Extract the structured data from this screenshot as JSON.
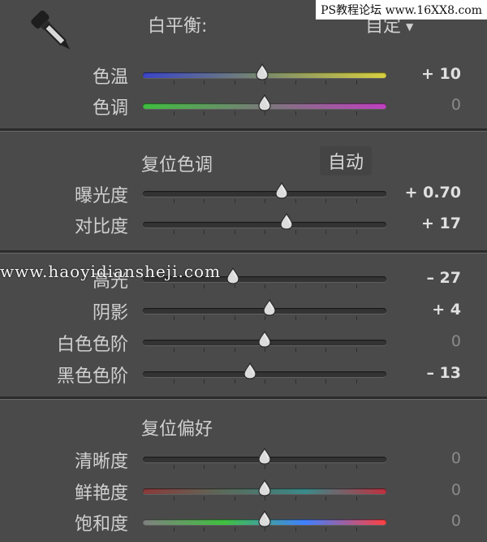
{
  "watermarks": {
    "top": "PS教程论坛 www.16XX8.com",
    "middle": "www.haoyidiansheji.com"
  },
  "white_balance": {
    "title": "白平衡:",
    "dropdown_value": "自定",
    "sliders": [
      {
        "label": "色温",
        "value": "+ 10",
        "dim": false,
        "position": 0.49,
        "gradient": "temp"
      },
      {
        "label": "色调",
        "value": "0",
        "dim": true,
        "position": 0.5,
        "gradient": "tint"
      }
    ]
  },
  "tone": {
    "title": "复位色调",
    "auto_label": "自动",
    "sliders": [
      {
        "label": "曝光度",
        "value": "+ 0.70",
        "dim": false,
        "position": 0.57
      },
      {
        "label": "对比度",
        "value": "+ 17",
        "dim": false,
        "position": 0.59
      }
    ]
  },
  "tone2": {
    "sliders": [
      {
        "label": "高光",
        "value": "– 27",
        "dim": false,
        "position": 0.37
      },
      {
        "label": "阴影",
        "value": "+ 4",
        "dim": false,
        "position": 0.52
      },
      {
        "label": "白色色阶",
        "value": "0",
        "dim": true,
        "position": 0.5
      },
      {
        "label": "黑色色阶",
        "value": "– 13",
        "dim": false,
        "position": 0.44
      }
    ]
  },
  "presence": {
    "title": "复位偏好",
    "sliders": [
      {
        "label": "清晰度",
        "value": "0",
        "dim": true,
        "position": 0.5,
        "gradient": "plain"
      },
      {
        "label": "鲜艳度",
        "value": "0",
        "dim": true,
        "position": 0.5,
        "gradient": "vib"
      },
      {
        "label": "饱和度",
        "value": "0",
        "dim": true,
        "position": 0.5,
        "gradient": "sat"
      }
    ]
  },
  "colors": {
    "background": "#4a4a4a",
    "separator": "#2b2b2b",
    "temp_gradient": [
      "#3a45c8",
      "#7a8a6a",
      "#d8d040"
    ],
    "tint_gradient": [
      "#3fbf3f",
      "#7a7a7a",
      "#c040c0"
    ],
    "vib_gradient": [
      "#8a3a3a",
      "#5a6a5a",
      "#3a8a8a",
      "#c03040"
    ],
    "sat_gradient": [
      "#808080",
      "#40c040",
      "#4080ff",
      "#ff4040"
    ]
  },
  "icons": {
    "eyedropper": "eyedropper-icon"
  }
}
